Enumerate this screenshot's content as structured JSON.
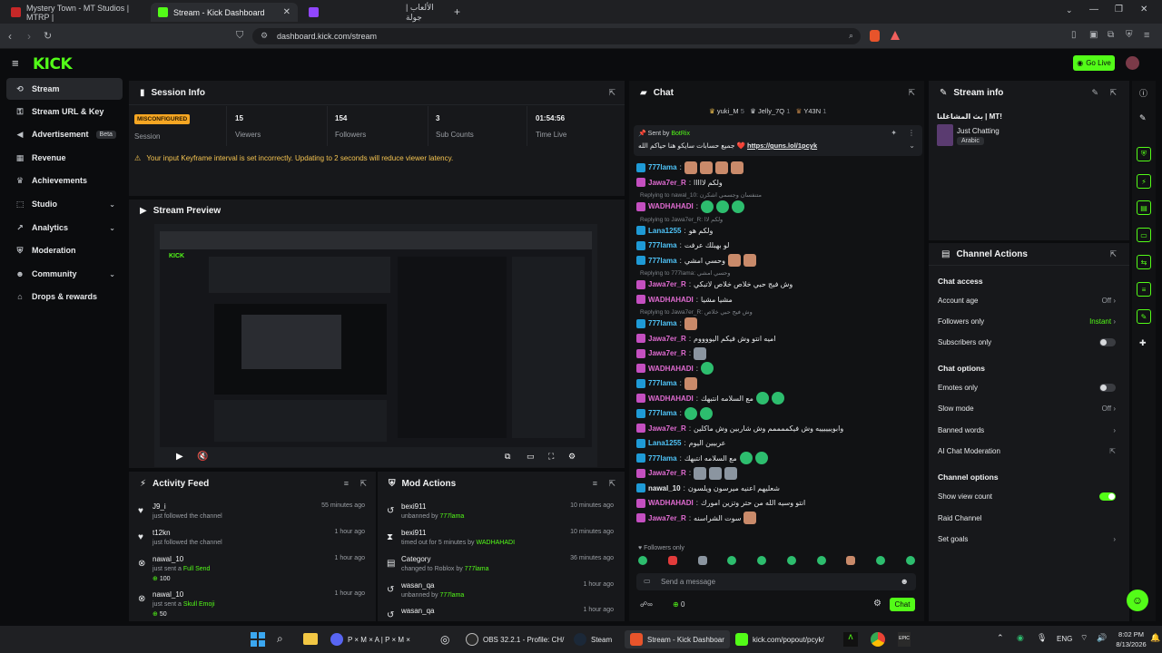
{
  "browser": {
    "tabs": [
      {
        "label": "Mystery Town - MT Studios | MTRP |"
      },
      {
        "label": "Stream - Kick Dashboard"
      },
      {
        "label": "الألعاب | جولة"
      }
    ],
    "url": "dashboard.kick.com/stream"
  },
  "header": {
    "logo": "KICK",
    "go_live": "Go Live"
  },
  "sidebar": {
    "items": [
      {
        "label": "Stream",
        "icon": "signal-icon"
      },
      {
        "label": "Stream URL & Key",
        "icon": "key-icon"
      },
      {
        "label": "Advertisement",
        "icon": "megaphone-icon",
        "badge": "Beta"
      },
      {
        "label": "Revenue",
        "icon": "bank-icon"
      },
      {
        "label": "Achievements",
        "icon": "trophy-icon"
      },
      {
        "label": "Studio",
        "icon": "studio-icon"
      },
      {
        "label": "Analytics",
        "icon": "chart-icon"
      },
      {
        "label": "Moderation",
        "icon": "shield-icon"
      },
      {
        "label": "Community",
        "icon": "people-icon"
      },
      {
        "label": "Drops & rewards",
        "icon": "gift-icon"
      }
    ]
  },
  "session": {
    "title": "Session Info",
    "status": "MISCONFIGURED",
    "status_label": "Session",
    "stats": [
      {
        "value": "15",
        "label": "Viewers"
      },
      {
        "value": "154",
        "label": "Followers"
      },
      {
        "value": "3",
        "label": "Sub Counts"
      },
      {
        "value": "01:54:56",
        "label": "Time Live"
      }
    ],
    "warning": "Your input Keyframe interval is set incorrectly. Updating to 2 seconds will reduce viewer latency."
  },
  "preview": {
    "title": "Stream Preview"
  },
  "activity": {
    "title": "Activity Feed",
    "items": [
      {
        "name": "J9_i",
        "action": "just followed the channel",
        "extra": "",
        "time": "55 minutes ago"
      },
      {
        "name": "t12kn",
        "action": "just followed the channel",
        "extra": "",
        "time": "1 hour ago"
      },
      {
        "name": "nawal_10",
        "action": "just sent a",
        "extra": "Full Send",
        "amount": "100",
        "time": "1 hour ago"
      },
      {
        "name": "nawal_10",
        "action": "just sent a",
        "extra": "Skull Emoji",
        "amount": "50",
        "time": "1 hour ago"
      }
    ]
  },
  "modactions": {
    "title": "Mod Actions",
    "items": [
      {
        "name": "bexi911",
        "action": "unbanned by",
        "by": "777lama",
        "time": "10 minutes ago"
      },
      {
        "name": "bexi911",
        "action": "timed out for 5 minutes by",
        "by": "WADHAHADI",
        "time": "10 minutes ago"
      },
      {
        "name": "Category",
        "action": "changed to Roblox by",
        "by": "777lama",
        "time": "36 minutes ago"
      },
      {
        "name": "wasan_qa",
        "action": "unbanned by",
        "by": "777lama",
        "time": "1 hour ago"
      },
      {
        "name": "wasan_qa",
        "action": "",
        "by": "",
        "time": "1 hour ago"
      }
    ]
  },
  "chat": {
    "title": "Chat",
    "top_users": [
      {
        "name": "yuki_M",
        "count": "5"
      },
      {
        "name": "Jelly_7Q",
        "count": "1"
      },
      {
        "name": "Y43N",
        "count": "1"
      }
    ],
    "pinned_by": "Sent by",
    "pinned_bot": "BotRix",
    "pinned_text": "جميع حسابات سايكو هنا حياكم الله ❤️",
    "pinned_link": "https://guns.lol/1pcyk",
    "lines": [
      {
        "user": "777lama",
        "color": "#4fc3f7",
        "text": ""
      },
      {
        "user": "Jawa7er_R",
        "color": "#e06bd1",
        "text": "ولكم لااااا"
      },
      {
        "reply": "Replying to nawal_10: متنفسان وجسمي اشكرن"
      },
      {
        "user": "WADHAHADI",
        "color": "#e06bd1",
        "text": ""
      },
      {
        "reply": "Replying to Jawa7er_R: ولكم لاا"
      },
      {
        "user": "Lana1255",
        "color": "#4fc3f7",
        "text": "ولكم هو"
      },
      {
        "user": "777lama",
        "color": "#4fc3f7",
        "text": "لو بهبلك عرفت"
      },
      {
        "user": "777lama",
        "color": "#4fc3f7",
        "text": "وحسي امشي"
      },
      {
        "reply": "Replying to 777lama: وحسي امشي"
      },
      {
        "user": "Jawa7er_R",
        "color": "#e06bd1",
        "text": "وش فيج حبي خلاص خلاص لاتبكي"
      },
      {
        "user": "WADHAHADI",
        "color": "#e06bd1",
        "text": "مشيا مشيا"
      },
      {
        "reply": "Replying to Jawa7er_R: وش فيج حبي خلاص"
      },
      {
        "user": "777lama",
        "color": "#4fc3f7",
        "text": ""
      },
      {
        "user": "Jawa7er_R",
        "color": "#e06bd1",
        "text": "اميه انتو وش فيكم اليووووم"
      },
      {
        "user": "Jawa7er_R",
        "color": "#e06bd1",
        "text": ""
      },
      {
        "user": "WADHAHADI",
        "color": "#e06bd1",
        "text": ""
      },
      {
        "user": "777lama",
        "color": "#4fc3f7",
        "text": ""
      },
      {
        "user": "WADHAHADI",
        "color": "#e06bd1",
        "text": "مع السلامه انتبهك"
      },
      {
        "user": "777lama",
        "color": "#4fc3f7",
        "text": ""
      },
      {
        "user": "Jawa7er_R",
        "color": "#e06bd1",
        "text": "وابوييييييه وش فيكممممم وش شاربين وش ماكلين"
      },
      {
        "user": "Lana1255",
        "color": "#4fc3f7",
        "text": "عربيين اليوم"
      },
      {
        "user": "777lama",
        "color": "#4fc3f7",
        "text": "مع السلامه انتبهك"
      },
      {
        "user": "Jawa7er_R",
        "color": "#e06bd1",
        "text": ""
      },
      {
        "user": "nawal_10",
        "color": "#e6e8ea",
        "text": "شعليهم اعنيه ميرسون ويلسون"
      },
      {
        "user": "WADHAHADI",
        "color": "#e06bd1",
        "text": "انتو وسيه الله من حتر وتزين امورك"
      },
      {
        "user": "Jawa7er_R",
        "color": "#e06bd1",
        "text": "سوت الشراسنه"
      }
    ],
    "followers_only": "Followers only",
    "input_placeholder": "Send a message",
    "viewer_count": "0",
    "send": "Chat"
  },
  "streaminfo": {
    "title": "Stream info",
    "stream_title": "بث المشاغلنا | MT!",
    "category": "Just Chatting",
    "language": "Arabic"
  },
  "channel": {
    "title": "Channel Actions",
    "chat_access": "Chat access",
    "account_age": {
      "label": "Account age",
      "value": "Off"
    },
    "followers_only": {
      "label": "Followers only",
      "value": "Instant"
    },
    "subscribers_only": {
      "label": "Subscribers only"
    },
    "chat_options": "Chat options",
    "emotes_only": {
      "label": "Emotes only"
    },
    "slow_mode": {
      "label": "Slow mode",
      "value": "Off"
    },
    "banned_words": {
      "label": "Banned words"
    },
    "ai_moderation": {
      "label": "AI Chat Moderation"
    },
    "channel_options": "Channel options",
    "show_view_count": {
      "label": "Show view count"
    },
    "raid": {
      "label": "Raid Channel"
    },
    "goals": {
      "label": "Set goals"
    }
  },
  "taskbar": {
    "items": [
      {
        "label": "P × M × A | P × M ×"
      },
      {
        "label": "OBS 32.2.1 - Profile: CH/"
      },
      {
        "label": "Steam"
      },
      {
        "label": "Stream - Kick Dashboar"
      },
      {
        "label": "kick.com/popout/pcyk/"
      }
    ],
    "lang": "ENG",
    "time": "8:02 PM",
    "date": "8/13/2026"
  },
  "colors": {
    "accent": "#53fc18",
    "warning": "#f5a623"
  }
}
